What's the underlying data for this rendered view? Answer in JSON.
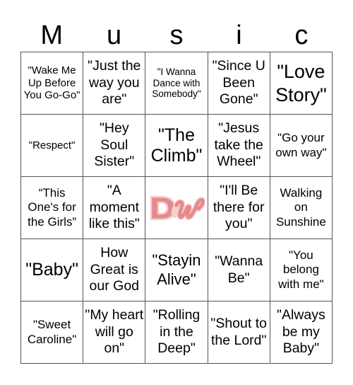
{
  "header": {
    "letters": [
      "M",
      "u",
      "s",
      "i",
      "c"
    ]
  },
  "cells": [
    [
      "\"Wake Me Up Before You Go-Go\"",
      "\"Just the way you are\"",
      "\"I Wanna Dance with Somebody\"",
      "\"Since U Been Gone\"",
      "\"Love Story\""
    ],
    [
      "\"Respect\"",
      "\"Hey Soul Sister\"",
      "\"The Climb\"",
      "\"Jesus take the Wheel\"",
      "\"Go your own way\""
    ],
    [
      "“This One's for the Girls”",
      "\"A moment like this\"",
      "",
      "\"I'll Be there for you\"",
      "Walking on Sunshine"
    ],
    [
      "\"Baby\"",
      "How Great is our God",
      "\"Stayin Alive\"",
      "\"Wanna Be\"",
      "\"You belong with me\""
    ],
    [
      "\"Sweet Caroline\"",
      "\"My heart will go on\"",
      "\"Rolling in the Deep\"",
      "\"Shout to the Lord\"",
      "\"Always be my Baby\""
    ]
  ],
  "free_space": {
    "icon": "dw-logo-icon",
    "text": "DW",
    "color": "#e58a8d"
  }
}
